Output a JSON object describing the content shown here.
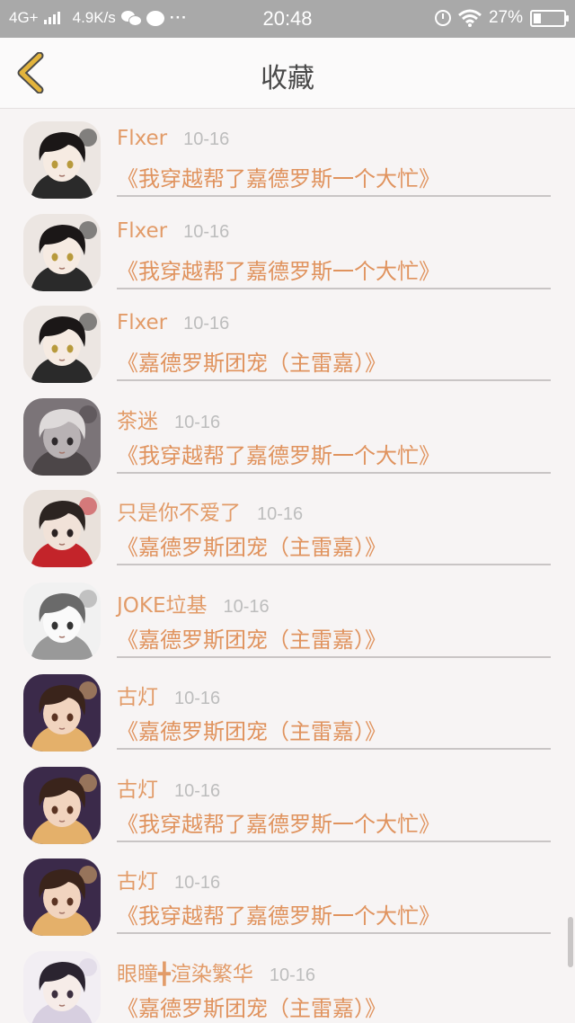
{
  "status_bar": {
    "network": "4G+",
    "speed": "4.9K/s",
    "icons": [
      "signal-icon",
      "wechat-icon",
      "message-icon",
      "more-icon",
      "alarm-icon",
      "wifi-icon",
      "battery-icon"
    ],
    "more": "···",
    "time": "20:48",
    "battery": "27%",
    "battery_level": 0.27
  },
  "header": {
    "title": "收藏",
    "back_icon": "chevron-left-icon",
    "accent": "#e3b43c"
  },
  "items": [
    {
      "user": "Flxer",
      "date": "10-16",
      "title": "《我穿越帮了嘉德罗斯一个大忙》"
    },
    {
      "user": "Flxer",
      "date": "10-16",
      "title": "《我穿越帮了嘉德罗斯一个大忙》"
    },
    {
      "user": "Flxer",
      "date": "10-16",
      "title": "《嘉德罗斯团宠（主雷嘉）》"
    },
    {
      "user": "茶迷",
      "date": "10-16",
      "title": "《我穿越帮了嘉德罗斯一个大忙》"
    },
    {
      "user": "只是你不爱了",
      "date": "10-16",
      "title": "《嘉德罗斯团宠（主雷嘉）》"
    },
    {
      "user": "JOKE垃基",
      "date": "10-16",
      "title": "《嘉德罗斯团宠（主雷嘉）》"
    },
    {
      "user": "古灯",
      "date": "10-16",
      "title": "《嘉德罗斯团宠（主雷嘉）》"
    },
    {
      "user": "古灯",
      "date": "10-16",
      "title": "《我穿越帮了嘉德罗斯一个大忙》"
    },
    {
      "user": "古灯",
      "date": "10-16",
      "title": "《我穿越帮了嘉德罗斯一个大忙》"
    },
    {
      "user": "眼瞳╋渲染繁华",
      "date": "10-16",
      "title": "《嘉德罗斯团宠（主雷嘉）》"
    }
  ],
  "colors": {
    "name": "#e29b68",
    "title": "#e0935e",
    "date": "#bdbdbd",
    "status_bar": "#a9a9a9"
  }
}
